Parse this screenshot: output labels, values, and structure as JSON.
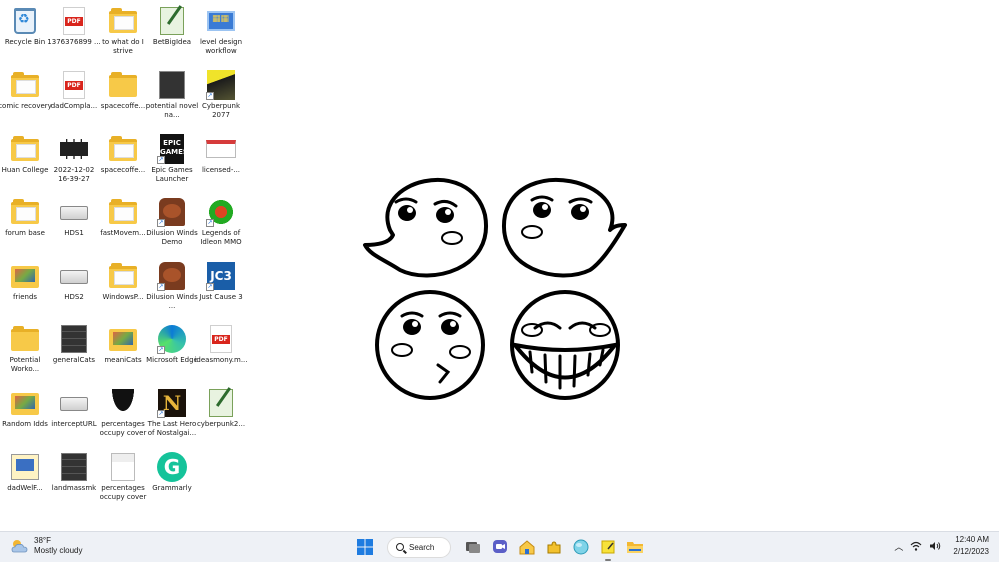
{
  "desktop": {
    "icons": [
      {
        "label": "Recycle Bin"
      },
      {
        "label": "1376376899 ..."
      },
      {
        "label": "to what do I strive"
      },
      {
        "label": "BetBigIdea"
      },
      {
        "label": "level design workflow"
      },
      {
        "label": "comic recovery"
      },
      {
        "label": "dadCompla..."
      },
      {
        "label": "spacecoffe..."
      },
      {
        "label": "potential novel na..."
      },
      {
        "label": "Cyberpunk 2077"
      },
      {
        "label": "Huan College"
      },
      {
        "label": "2022-12-02 16-39-27"
      },
      {
        "label": "spacecoffe..."
      },
      {
        "label": "Epic Games Launcher"
      },
      {
        "label": "licensed-..."
      },
      {
        "label": "forum base"
      },
      {
        "label": "HDS1"
      },
      {
        "label": "fastMovem..."
      },
      {
        "label": "Dilusion Winds Demo"
      },
      {
        "label": "Legends of Idleon MMO"
      },
      {
        "label": "friends"
      },
      {
        "label": "HDS2"
      },
      {
        "label": "WindowsP..."
      },
      {
        "label": "Dilusion Winds ..."
      },
      {
        "label": "Just Cause 3"
      },
      {
        "label": "Potential Worko..."
      },
      {
        "label": "generalCats"
      },
      {
        "label": "meaniCats"
      },
      {
        "label": "Microsoft Edge"
      },
      {
        "label": "ideasmony.m..."
      },
      {
        "label": "Random Idds"
      },
      {
        "label": "interceptURL"
      },
      {
        "label": "percentages occupy cover"
      },
      {
        "label": "The Last Hero of Nostalgai..."
      },
      {
        "label": "cyberpunk2..."
      },
      {
        "label": "dadWelF..."
      },
      {
        "label": "landmassmk"
      },
      {
        "label": "percentages occupy cover"
      },
      {
        "label": "Grammarly"
      }
    ]
  },
  "taskbar": {
    "weather": {
      "temp": "38°F",
      "condition": "Mostly cloudy"
    },
    "search_label": "Search",
    "clock": {
      "time": "12:40 AM",
      "date": "2/12/2023"
    }
  },
  "icons": {
    "jc3_text": "JC3",
    "epic_text": "EPIC GAMES",
    "lasthero_text": "N",
    "grammarly_text": "G"
  }
}
